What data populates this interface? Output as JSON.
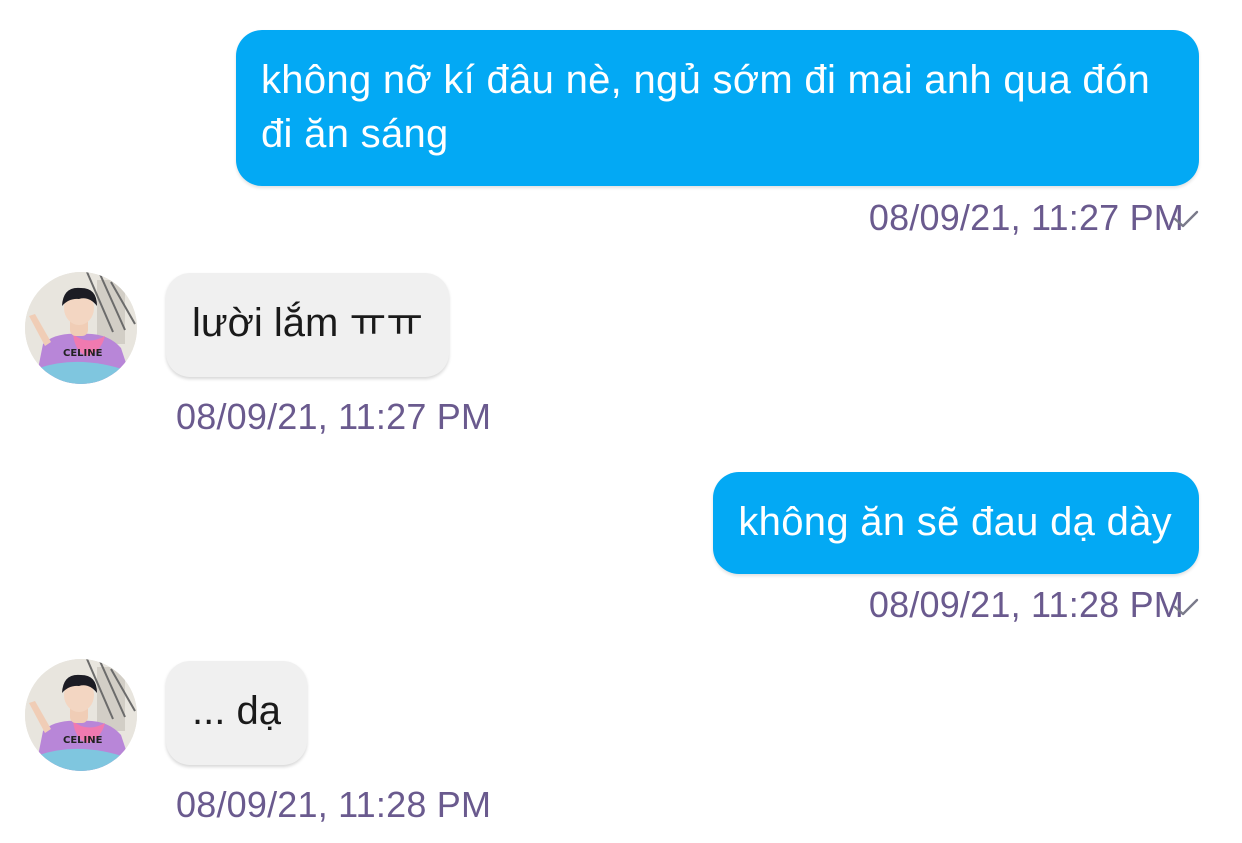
{
  "messages": [
    {
      "direction": "out",
      "text": "không nỡ kí đâu nè, ngủ sớm đi mai anh qua đón đi ăn sáng",
      "timestamp": "08/09/21, 11:27 PM",
      "status_icon": "check-icon"
    },
    {
      "direction": "in",
      "text": "lười lắm ㅠㅠ",
      "timestamp": "08/09/21, 11:27 PM",
      "avatar_icon": "contact-avatar"
    },
    {
      "direction": "out",
      "text": "không ăn sẽ đau dạ dày",
      "timestamp": "08/09/21, 11:28 PM",
      "status_icon": "check-icon"
    },
    {
      "direction": "in",
      "text": "... dạ",
      "timestamp": "08/09/21, 11:28 PM",
      "avatar_icon": "contact-avatar"
    }
  ],
  "avatar_shirt_text": "CELINE",
  "colors": {
    "outgoing_bubble": "#03a9f4",
    "outgoing_text": "#ffffff",
    "incoming_bubble": "#f0f0f0",
    "incoming_text": "#1a1a1a",
    "timestamp": "#6a5a8e",
    "check": "#7a7a8a"
  }
}
